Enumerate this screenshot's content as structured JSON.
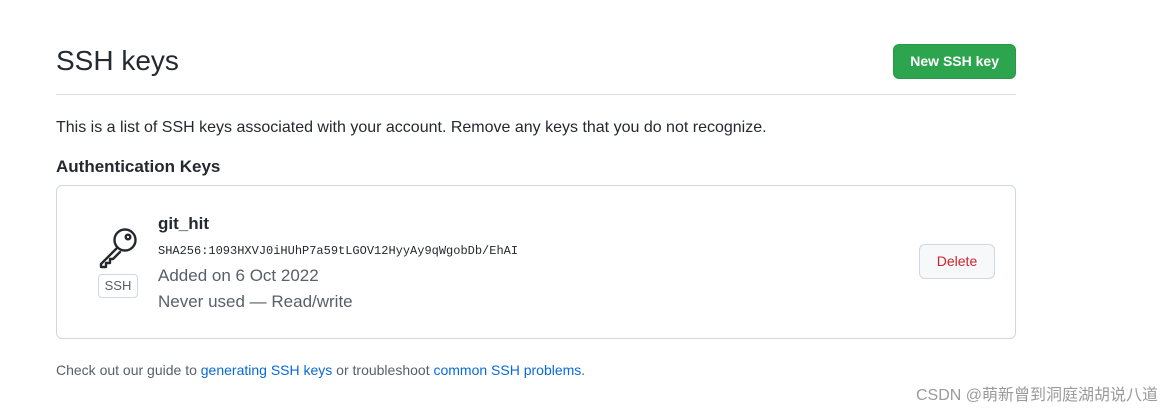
{
  "header": {
    "title": "SSH keys",
    "new_button_label": "New SSH key"
  },
  "description": "This is a list of SSH keys associated with your account. Remove any keys that you do not recognize.",
  "auth_keys": {
    "heading": "Authentication Keys",
    "items": [
      {
        "icon": "key-icon",
        "badge": "SSH",
        "name": "git_hit",
        "fingerprint": "SHA256:1093HXVJ0iHUhP7a59tLGOV12HyyAy9qWgobDb/EhAI",
        "added": "Added on 6 Oct 2022",
        "usage": "Never used — Read/write",
        "delete_label": "Delete"
      }
    ]
  },
  "footer": {
    "prefix": "Check out our guide to ",
    "link1": "generating SSH keys",
    "middle": " or troubleshoot ",
    "link2": "common SSH problems",
    "suffix": "."
  },
  "watermark": "CSDN @萌新曾到洞庭湖胡说八道",
  "colors": {
    "primary_button": "#2da44e",
    "danger_text": "#cf222e",
    "link": "#0969da",
    "muted_text": "#57606a",
    "border": "#d0d7de"
  }
}
